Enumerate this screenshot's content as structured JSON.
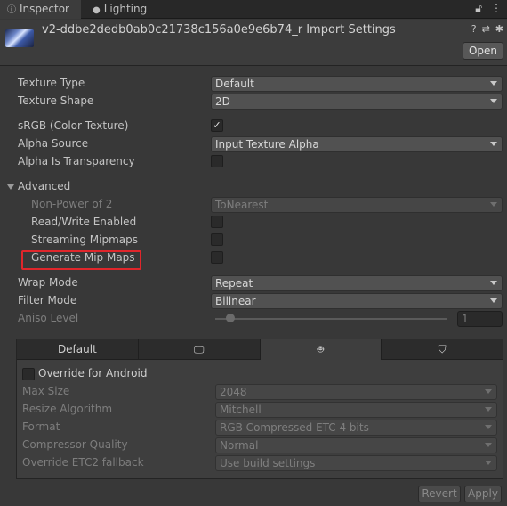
{
  "tabs": [
    {
      "label": "Inspector",
      "icon": "info-icon",
      "active": true
    },
    {
      "label": "Lighting",
      "icon": "lightbulb-icon",
      "active": false
    }
  ],
  "tabbar_icons": [
    "lock-icon",
    "kebab-menu-icon"
  ],
  "header": {
    "title": "v2-ddbe2dedb0ab0c21738c156a0e9e6b74_r Import Settings",
    "icons": [
      "help-icon",
      "preset-icon",
      "settings-icon"
    ],
    "open_label": "Open"
  },
  "settings": {
    "texture_type": {
      "label": "Texture Type",
      "value": "Default"
    },
    "texture_shape": {
      "label": "Texture Shape",
      "value": "2D"
    },
    "srgb": {
      "label": "sRGB (Color Texture)",
      "checked": true
    },
    "alpha_source": {
      "label": "Alpha Source",
      "value": "Input Texture Alpha"
    },
    "alpha_is_transparency": {
      "label": "Alpha Is Transparency",
      "checked": false
    },
    "advanced": {
      "label": "Advanced"
    },
    "non_power_of_2": {
      "label": "Non-Power of 2",
      "value": "ToNearest"
    },
    "read_write": {
      "label": "Read/Write Enabled",
      "checked": false
    },
    "streaming_mipmaps": {
      "label": "Streaming Mipmaps",
      "checked": false
    },
    "generate_mip_maps": {
      "label": "Generate Mip Maps",
      "checked": false
    },
    "wrap_mode": {
      "label": "Wrap Mode",
      "value": "Repeat"
    },
    "filter_mode": {
      "label": "Filter Mode",
      "value": "Bilinear"
    },
    "aniso_level": {
      "label": "Aniso Level",
      "value": "1"
    }
  },
  "platform": {
    "tabs": [
      {
        "label": "Default",
        "icon": ""
      },
      {
        "label": "",
        "icon": "monitor-icon"
      },
      {
        "label": "",
        "icon": "android-icon"
      },
      {
        "label": "",
        "icon": "html5-icon"
      }
    ],
    "override_label": "Override for Android",
    "rows": [
      {
        "label": "Max Size",
        "value": "2048"
      },
      {
        "label": "Resize Algorithm",
        "value": "Mitchell"
      },
      {
        "label": "Format",
        "value": "RGB Compressed ETC 4 bits"
      },
      {
        "label": "Compressor Quality",
        "value": "Normal"
      },
      {
        "label": "Override ETC2 fallback",
        "value": "Use build settings"
      }
    ]
  },
  "footer": {
    "revert_label": "Revert",
    "apply_label": "Apply"
  },
  "colors": {
    "highlight": "#e0262b",
    "background": "#383838"
  }
}
